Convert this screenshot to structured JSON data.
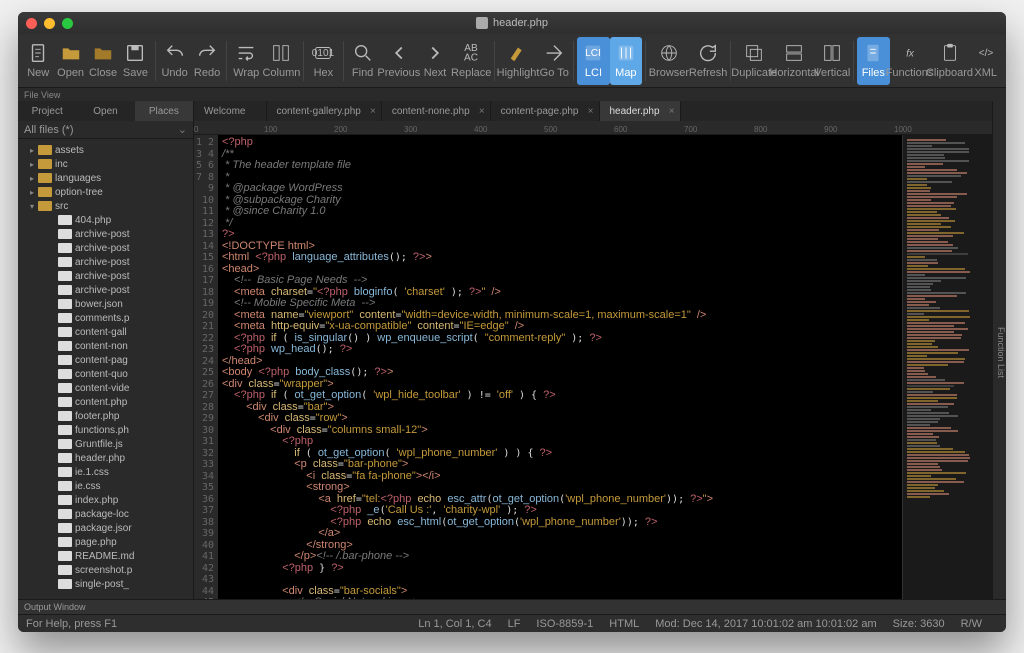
{
  "window": {
    "title": "header.php"
  },
  "toolbar": [
    {
      "label": "New",
      "icon": "doc"
    },
    {
      "label": "Open",
      "icon": "folder-open"
    },
    {
      "label": "Close",
      "icon": "folder-close"
    },
    {
      "label": "Save",
      "icon": "save"
    },
    {
      "sep": true
    },
    {
      "label": "Undo",
      "icon": "undo"
    },
    {
      "label": "Redo",
      "icon": "redo"
    },
    {
      "sep": true
    },
    {
      "label": "Wrap",
      "icon": "wrap"
    },
    {
      "label": "Column",
      "icon": "column"
    },
    {
      "sep": true
    },
    {
      "label": "Hex",
      "icon": "hex"
    },
    {
      "sep": true
    },
    {
      "label": "Find",
      "icon": "find"
    },
    {
      "label": "Previous",
      "icon": "prev"
    },
    {
      "label": "Next",
      "icon": "next"
    },
    {
      "label": "Replace",
      "icon": "replace"
    },
    {
      "sep": true
    },
    {
      "label": "Highlight",
      "icon": "highlight"
    },
    {
      "label": "Go To",
      "icon": "goto"
    },
    {
      "sep": true
    },
    {
      "label": "LCI",
      "icon": "lci",
      "sel": true
    },
    {
      "label": "Map",
      "icon": "map",
      "sel2": true
    },
    {
      "sep": true
    },
    {
      "label": "Browser",
      "icon": "browser"
    },
    {
      "label": "Refresh",
      "icon": "refresh"
    },
    {
      "sep": true
    },
    {
      "label": "Duplicate",
      "icon": "duplicate"
    },
    {
      "label": "Horizontal",
      "icon": "horiz"
    },
    {
      "label": "Vertical",
      "icon": "vert"
    },
    {
      "sep": true
    },
    {
      "label": "Files",
      "icon": "files",
      "sel": true
    },
    {
      "label": "Functions",
      "icon": "functions"
    },
    {
      "label": "Clipboard",
      "icon": "clipboard"
    },
    {
      "label": "XML",
      "icon": "xml"
    }
  ],
  "fileview_label": "File View",
  "side_tabs": [
    "Project",
    "Open",
    "Places"
  ],
  "side_tab_active": 2,
  "allfiles": "All files (*)",
  "tree": [
    {
      "type": "folder",
      "name": "assets",
      "indent": 1
    },
    {
      "type": "folder",
      "name": "inc",
      "indent": 1
    },
    {
      "type": "folder",
      "name": "languages",
      "indent": 1
    },
    {
      "type": "folder",
      "name": "option-tree",
      "indent": 1
    },
    {
      "type": "folder",
      "name": "src",
      "indent": 1,
      "expanded": true
    },
    {
      "type": "file",
      "name": "404.php",
      "indent": 2
    },
    {
      "type": "file",
      "name": "archive-post",
      "indent": 2
    },
    {
      "type": "file",
      "name": "archive-post",
      "indent": 2
    },
    {
      "type": "file",
      "name": "archive-post",
      "indent": 2
    },
    {
      "type": "file",
      "name": "archive-post",
      "indent": 2
    },
    {
      "type": "file",
      "name": "archive-post",
      "indent": 2
    },
    {
      "type": "file",
      "name": "bower.json",
      "indent": 2
    },
    {
      "type": "file",
      "name": "comments.p",
      "indent": 2
    },
    {
      "type": "file",
      "name": "content-gall",
      "indent": 2
    },
    {
      "type": "file",
      "name": "content-non",
      "indent": 2
    },
    {
      "type": "file",
      "name": "content-pag",
      "indent": 2
    },
    {
      "type": "file",
      "name": "content-quo",
      "indent": 2
    },
    {
      "type": "file",
      "name": "content-vide",
      "indent": 2
    },
    {
      "type": "file",
      "name": "content.php",
      "indent": 2
    },
    {
      "type": "file",
      "name": "footer.php",
      "indent": 2
    },
    {
      "type": "file",
      "name": "functions.ph",
      "indent": 2
    },
    {
      "type": "file",
      "name": "Gruntfile.js",
      "indent": 2
    },
    {
      "type": "file",
      "name": "header.php",
      "indent": 2
    },
    {
      "type": "file",
      "name": "ie.1.css",
      "indent": 2
    },
    {
      "type": "file",
      "name": "ie.css",
      "indent": 2
    },
    {
      "type": "file",
      "name": "index.php",
      "indent": 2
    },
    {
      "type": "file",
      "name": "package-loc",
      "indent": 2
    },
    {
      "type": "file",
      "name": "package.jsor",
      "indent": 2
    },
    {
      "type": "file",
      "name": "page.php",
      "indent": 2
    },
    {
      "type": "file",
      "name": "README.md",
      "indent": 2
    },
    {
      "type": "file",
      "name": "screenshot.p",
      "indent": 2
    },
    {
      "type": "file",
      "name": "single-post_",
      "indent": 2
    }
  ],
  "tabs": [
    {
      "label": "Welcome"
    },
    {
      "label": "content-gallery.php",
      "close": true
    },
    {
      "label": "content-none.php",
      "close": true
    },
    {
      "label": "content-page.php",
      "close": true
    },
    {
      "label": "header.php",
      "close": true,
      "active": true
    }
  ],
  "ruler_marks": [
    0,
    100,
    200,
    300,
    400,
    500,
    600,
    700,
    800,
    900,
    1000
  ],
  "line_start": 1,
  "line_end": 45,
  "code": "<span class='t-php'>&lt;?php</span>\n<span class='t-com'>/**</span>\n<span class='t-com'> * The header template file</span>\n<span class='t-com'> *</span>\n<span class='t-com'> * @package WordPress</span>\n<span class='t-com'> * @subpackage Charity</span>\n<span class='t-com'> * @since Charity 1.0</span>\n<span class='t-com'> */</span>\n<span class='t-php'>?&gt;</span>\n<span class='t-tag'>&lt;!DOCTYPE html&gt;</span>\n<span class='t-tag'>&lt;html</span> <span class='t-php'>&lt;?php</span> <span class='t-fn'>language_attributes</span>(); <span class='t-php'>?&gt;</span><span class='t-tag'>&gt;</span>\n<span class='t-tag'>&lt;head&gt;</span>\n  <span class='t-com'>&lt;!--  Basic Page Needs  --&gt;</span>\n  <span class='t-tag'>&lt;meta</span> <span class='t-attr'>charset</span>=<span class='t-str'>\"</span><span class='t-php'>&lt;?php</span> <span class='t-fn'>bloginfo</span>( <span class='t-str'>'charset'</span> ); <span class='t-php'>?&gt;</span><span class='t-str'>\"</span> <span class='t-tag'>/&gt;</span>\n  <span class='t-com'>&lt;!-- Mobile Specific Meta  --&gt;</span>\n  <span class='t-tag'>&lt;meta</span> <span class='t-attr'>name</span>=<span class='t-str'>\"viewport\"</span> <span class='t-attr'>content</span>=<span class='t-str'>\"width=device-width, minimum-scale=1, maximum-scale=1\"</span> <span class='t-tag'>/&gt;</span>\n  <span class='t-tag'>&lt;meta</span> <span class='t-attr'>http-equiv</span>=<span class='t-str'>\"x-ua-compatible\"</span> <span class='t-attr'>content</span>=<span class='t-str'>\"IE=edge\"</span> <span class='t-tag'>/&gt;</span>\n  <span class='t-php'>&lt;?php</span> <span class='t-key'>if</span> ( <span class='t-fn'>is_singular</span>() ) <span class='t-fn'>wp_enqueue_script</span>( <span class='t-str'>\"comment-reply\"</span> ); <span class='t-php'>?&gt;</span>\n  <span class='t-php'>&lt;?php</span> <span class='t-fn'>wp_head</span>(); <span class='t-php'>?&gt;</span>\n<span class='t-tag'>&lt;/head&gt;</span>\n<span class='t-tag'>&lt;body</span> <span class='t-php'>&lt;?php</span> <span class='t-fn'>body_class</span>(); <span class='t-php'>?&gt;</span><span class='t-tag'>&gt;</span>\n<span class='t-tag'>&lt;div</span> <span class='t-attr'>class</span>=<span class='t-str'>\"wrapper\"</span><span class='t-tag'>&gt;</span>\n  <span class='t-php'>&lt;?php</span> <span class='t-key'>if</span> ( <span class='t-fn'>ot_get_option</span>( <span class='t-str'>'wpl_hide_toolbar'</span> ) != <span class='t-str'>'off'</span> ) { <span class='t-php'>?&gt;</span>\n    <span class='t-tag'>&lt;div</span> <span class='t-attr'>class</span>=<span class='t-str'>\"bar\"</span><span class='t-tag'>&gt;</span>\n      <span class='t-tag'>&lt;div</span> <span class='t-attr'>class</span>=<span class='t-str'>\"row\"</span><span class='t-tag'>&gt;</span>\n        <span class='t-tag'>&lt;div</span> <span class='t-attr'>class</span>=<span class='t-str'>\"columns small-12\"</span><span class='t-tag'>&gt;</span>\n          <span class='t-php'>&lt;?php</span>\n            <span class='t-key'>if</span> ( <span class='t-fn'>ot_get_option</span>( <span class='t-str'>'wpl_phone_number'</span> ) ) { <span class='t-php'>?&gt;</span>\n            <span class='t-tag'>&lt;p</span> <span class='t-attr'>class</span>=<span class='t-str'>\"bar-phone\"</span><span class='t-tag'>&gt;</span>\n              <span class='t-tag'>&lt;i</span> <span class='t-attr'>class</span>=<span class='t-str'>\"fa fa-phone\"</span><span class='t-tag'>&gt;&lt;/i&gt;</span>\n              <span class='t-tag'>&lt;strong&gt;</span>\n                <span class='t-tag'>&lt;a</span> <span class='t-attr'>href</span>=<span class='t-str'>\"tel:</span><span class='t-php'>&lt;?php</span> <span class='t-key'>echo</span> <span class='t-fn'>esc_attr</span>(<span class='t-fn'>ot_get_option</span>(<span class='t-str'>'wpl_phone_number'</span>)); <span class='t-php'>?&gt;</span><span class='t-str'>\"</span><span class='t-tag'>&gt;</span>\n                  <span class='t-php'>&lt;?php</span> <span class='t-fn'>_e</span>(<span class='t-str'>'Call Us :'</span>, <span class='t-str'>'charity-wpl'</span> ); <span class='t-php'>?&gt;</span>\n                  <span class='t-php'>&lt;?php</span> <span class='t-key'>echo</span> <span class='t-fn'>esc_html</span>(<span class='t-fn'>ot_get_option</span>(<span class='t-str'>'wpl_phone_number'</span>)); <span class='t-php'>?&gt;</span>\n                <span class='t-tag'>&lt;/a&gt;</span>\n              <span class='t-tag'>&lt;/strong&gt;</span>\n            <span class='t-tag'>&lt;/p&gt;</span><span class='t-com'>&lt;!-- /.bar-phone --&gt;</span>\n          <span class='t-php'>&lt;?php</span> } <span class='t-php'>?&gt;</span>\n\n          <span class='t-tag'>&lt;div</span> <span class='t-attr'>class</span>=<span class='t-str'>\"bar-socials\"</span><span class='t-tag'>&gt;</span>\n            <span class='t-com'>&lt;!-- Social Networking --&gt;</span>\n            <span class='t-tag'>&lt;ul&gt;</span>\n              <span class='t-php'>&lt;?php</span> <span class='t-var'>$wplook_toolbar_share</span> = <span class='t-fn'>ot_get_option</span>( <span class='t-str'>'wpl_toolbar_share'</span>, <span class='t-key'>array</span>() ); <span class='t-php'>?&gt;</span>\n              <span class='t-php'>&lt;?php</span> <span class='t-key'>if</span>( <span class='t-var'>$wplook_toolbar_share</span> )",
  "output_window": "Output Window",
  "status": {
    "help": "For Help, press F1",
    "pos": "Ln 1, Col 1, C4",
    "lineend": "LF",
    "encoding": "ISO-8859-1",
    "lang": "HTML",
    "mod": "Mod: Dec 14, 2017 10:01:02 am 10:01:02 am",
    "size": "Size: 3630",
    "rw": "R/W"
  },
  "side_right": "Function List"
}
